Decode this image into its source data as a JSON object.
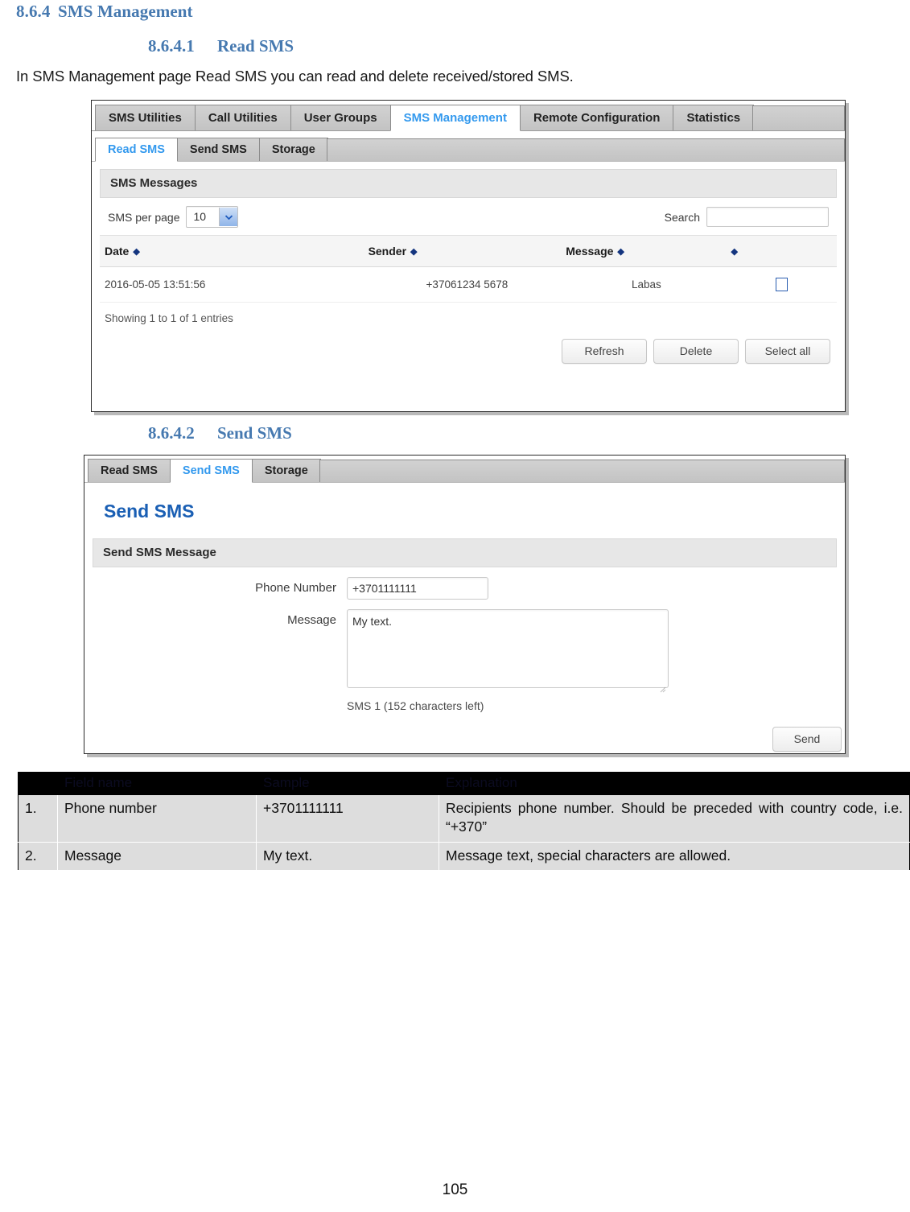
{
  "doc": {
    "heading_section": {
      "number": "8.6.4",
      "title": "SMS Management"
    },
    "heading_read": {
      "number": "8.6.4.1",
      "title": "Read SMS"
    },
    "intro_paragraph": "In SMS Management page Read SMS you can read and delete received/stored SMS.",
    "heading_send": {
      "number": "8.6.4.2",
      "title": "Send SMS"
    },
    "page_number": "105"
  },
  "read_sms_screenshot": {
    "main_tabs": [
      {
        "label": "SMS Utilities",
        "active": false
      },
      {
        "label": "Call Utilities",
        "active": false
      },
      {
        "label": "User Groups",
        "active": false
      },
      {
        "label": "SMS Management",
        "active": true
      },
      {
        "label": "Remote Configuration",
        "active": false
      },
      {
        "label": "Statistics",
        "active": false
      }
    ],
    "sub_tabs": [
      {
        "label": "Read SMS",
        "active": true
      },
      {
        "label": "Send SMS",
        "active": false
      },
      {
        "label": "Storage",
        "active": false
      }
    ],
    "section_title": "SMS Messages",
    "per_page_label": "SMS per page",
    "per_page_value": "10",
    "search_label": "Search",
    "search_value": "",
    "search_placeholder": "",
    "table": {
      "headers": [
        "Date",
        "Sender",
        "Message",
        ""
      ],
      "rows": [
        {
          "date": "2016-05-05 13:51:56",
          "sender": "+37061234 5678",
          "message": "Labas",
          "selected": false
        }
      ]
    },
    "entries_info": "Showing 1 to 1 of 1 entries",
    "buttons": [
      {
        "label": "Refresh"
      },
      {
        "label": "Delete"
      },
      {
        "label": "Select all"
      }
    ]
  },
  "send_sms_screenshot": {
    "sub_tabs": [
      {
        "label": "Read SMS",
        "active": false
      },
      {
        "label": "Send SMS",
        "active": true
      },
      {
        "label": "Storage",
        "active": false
      }
    ],
    "page_title": "Send SMS",
    "section_title": "Send SMS Message",
    "fields": {
      "phone_label": "Phone Number",
      "phone_value": "+3701111111",
      "message_label": "Message",
      "message_value": "My text.",
      "char_count": "SMS 1 (152 characters left)"
    },
    "send_button": "Send"
  },
  "parameter_table": {
    "headers": [
      "",
      "Field name",
      "Sample",
      "Explanation"
    ],
    "rows": [
      {
        "num": "1.",
        "field": "Phone number",
        "sample": "+3701111111",
        "explanation": "Recipients phone number. Should be preceded with country code, i.e. “+370”"
      },
      {
        "num": "2.",
        "field": "Message",
        "sample": "My text.",
        "explanation": "Message text, special characters are allowed."
      }
    ]
  },
  "colors": {
    "heading_blue": "#4679b0",
    "tab_active_blue": "#3399ee",
    "page_title_blue": "#1a5fb4",
    "sort_arrow": "#14357f",
    "checkbox_border": "#2a5db0",
    "table_header_bg": "#000000",
    "table_row_bg": "#dddddd"
  }
}
